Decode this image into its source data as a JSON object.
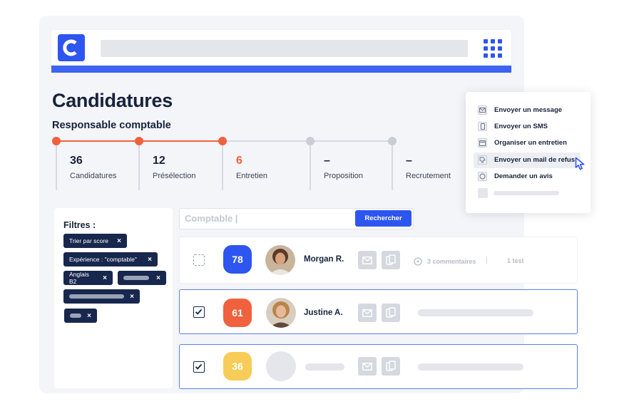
{
  "page": {
    "title": "Candidatures",
    "job_title": "Responsable comptable"
  },
  "colors": {
    "brand": "#2d55f0",
    "navy": "#17274d",
    "orange": "#f0613d",
    "yellow": "#f7cc58",
    "stage_active": "#f0613d",
    "stage_inactive": "#c9cdd6"
  },
  "pipeline": {
    "stages": [
      {
        "count": "36",
        "label": "Candidatures",
        "state": "done"
      },
      {
        "count": "12",
        "label": "Présélection",
        "state": "done"
      },
      {
        "count": "6",
        "label": "Entretien",
        "state": "current"
      },
      {
        "count": "–",
        "label": "Proposition",
        "state": "pending"
      },
      {
        "count": "–",
        "label": "Recrutement",
        "state": "pending"
      }
    ]
  },
  "filters": {
    "title": "Filtres :",
    "chips": [
      {
        "label": "Trier par score",
        "remove": "×"
      },
      {
        "label": "Expérience : \"comptable\"",
        "remove": "×"
      },
      {
        "label": "Anglais B2",
        "remove": "×"
      },
      {
        "label": "",
        "remove": "×"
      },
      {
        "label": "",
        "remove": "×"
      },
      {
        "label": "",
        "remove": "×"
      }
    ]
  },
  "search": {
    "value": "Comptable |",
    "button_label": "Rechercher"
  },
  "candidates": [
    {
      "score": "78",
      "name": "Morgan R.",
      "comments": "3 commentaires",
      "separator": "|",
      "tests": "1 test",
      "checked": false
    },
    {
      "score": "61",
      "name": "Justine A.",
      "checked": true
    },
    {
      "score": "36",
      "name": "",
      "checked": true
    }
  ],
  "icons": {
    "logo": "c-logo-icon",
    "apps": "grid-icon",
    "mail": "mail-icon",
    "document": "document-icon",
    "comment": "comment-icon",
    "check": "check-icon",
    "cursor": "cursor-icon"
  },
  "actions_menu": {
    "items": [
      {
        "label": "Envoyer un message",
        "icon": "mail-icon"
      },
      {
        "label": "Envoyer un SMS",
        "icon": "phone-icon"
      },
      {
        "label": "Organiser un entretien",
        "icon": "calendar-icon"
      },
      {
        "label": "Envoyer un mail de refus",
        "icon": "thumbs-down-icon"
      },
      {
        "label": "Demander un avis",
        "icon": "chat-icon"
      }
    ],
    "highlighted_index": 3
  }
}
